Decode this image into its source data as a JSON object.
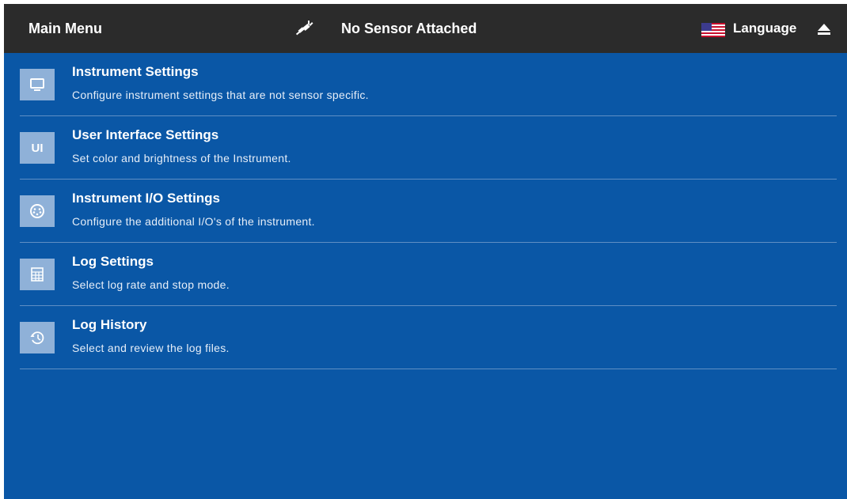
{
  "header": {
    "title": "Main Menu",
    "sensor_status": "No Sensor Attached",
    "language_label": "Language",
    "sensor_icon": "sensor-disconnected-icon",
    "flag_icon": "us-flag-icon",
    "eject_icon": "eject-icon"
  },
  "colors": {
    "background": "#0a57a6",
    "header_background": "#2b2b2b",
    "icon_tile": "#8fb1d8",
    "divider": "#5f8fc4"
  },
  "menu": {
    "items": [
      {
        "title": "Instrument Settings",
        "description": "Configure instrument settings that are not sensor specific.",
        "icon": "monitor-icon"
      },
      {
        "title": "User Interface Settings",
        "description": "Set color and brightness of the Instrument.",
        "icon": "ui-icon",
        "icon_text": "UI"
      },
      {
        "title": "Instrument I/O Settings",
        "description": "Configure the additional I/O's of the instrument.",
        "icon": "connector-icon"
      },
      {
        "title": "Log Settings",
        "description": "Select log rate and stop mode.",
        "icon": "log-grid-icon"
      },
      {
        "title": "Log History",
        "description": "Select and review the log files.",
        "icon": "history-icon"
      }
    ]
  }
}
